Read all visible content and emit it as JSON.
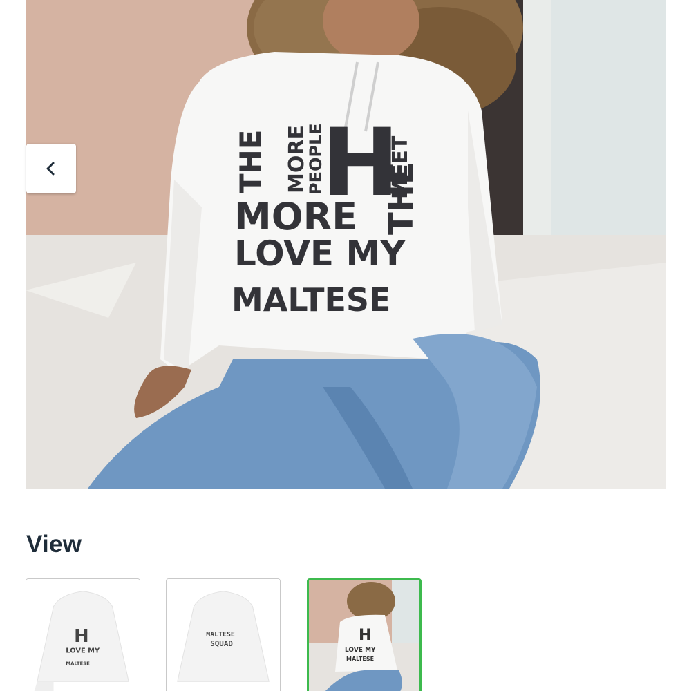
{
  "main_image": {
    "print_lines": {
      "the": "THE",
      "more_small": "MORE",
      "people": "PEOPLE",
      "big_h": "H",
      "meet": "MEET",
      "the_right": "THE",
      "more_big": "MORE",
      "love_my": "LOVE MY",
      "maltese": "MALTESE"
    }
  },
  "gallery": {
    "prev_icon": "chevron-left-icon"
  },
  "view": {
    "heading": "View",
    "thumbnails": [
      {
        "name": "front",
        "print_top": "H",
        "print_line": "LOVE MY",
        "print_small": "MALTESE",
        "selected": false
      },
      {
        "name": "back",
        "print_line1": "MALTESE",
        "print_line2": "SQUAD",
        "selected": false
      },
      {
        "name": "model",
        "print_top": "H",
        "print_line": "LOVE MY",
        "print_small": "MALTESE",
        "selected": true,
        "border_color": "#3dba4e"
      }
    ]
  }
}
